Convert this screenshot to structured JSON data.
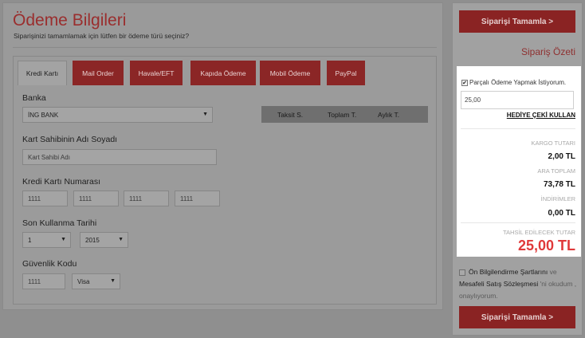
{
  "header": {
    "title": "Ödeme Bilgileri",
    "subtitle": "Siparişinizi tamamlamak için lütfen bir ödeme türü seçiniz?"
  },
  "tabs": [
    {
      "label": "Kredi Kartı",
      "active": true
    },
    {
      "label": "Mail Order"
    },
    {
      "label": "Havale/EFT"
    },
    {
      "label": "Kapıda Ödeme"
    },
    {
      "label": "Mobil Ödeme"
    },
    {
      "label": "PayPal"
    }
  ],
  "form": {
    "bank_label": "Banka",
    "bank_value": "İNG BANK",
    "holder_label": "Kart Sahibinin Adı Soyadı",
    "holder_placeholder": "Kart Sahibi Adı",
    "number_label": "Kredi Kartı Numarası",
    "number_parts": [
      "1111",
      "1111",
      "1111",
      "1111"
    ],
    "expiry_label": "Son Kullanma Tarihi",
    "expiry_month": "1",
    "expiry_year": "2015",
    "cvv_label": "Güvenlik Kodu",
    "cvv_value": "1111",
    "card_type": "Visa"
  },
  "installments": {
    "columns": [
      "Taksit S.",
      "Toplam T.",
      "Aylık T."
    ]
  },
  "sidebar": {
    "complete_button": "Siparişi Tamamla >",
    "summary_title": "Sipariş Özeti",
    "partial_payment_label": "Parçalı Ödeme Yapmak İstiyorum.",
    "partial_payment_checked": true,
    "amount_value": "25,00",
    "gift_link": "HEDİYE ÇEKİ KULLAN",
    "cargo_label": "KARGO TUTARI",
    "cargo_value": "2,00 TL",
    "subtotal_label": "ARA TOPLAM",
    "subtotal_value": "73,78 TL",
    "discount_label": "İNDİRİMLER",
    "discount_value": "0,00 TL",
    "total_label": "TAHSİL EDİLECEK TUTAR",
    "total_value": "25,00 TL",
    "terms_part1": "Ön Bilgilendirme Şartlarını",
    "terms_and": "ve",
    "terms_part2": "Mesafeli Satış Sözleşmesi",
    "terms_suffix": "'ni okudum , onaylıyorum.",
    "complete_button_bottom": "Siparişi Tamamla >"
  },
  "colors": {
    "brand_red": "#8a2323",
    "total_red": "#e0393a"
  }
}
